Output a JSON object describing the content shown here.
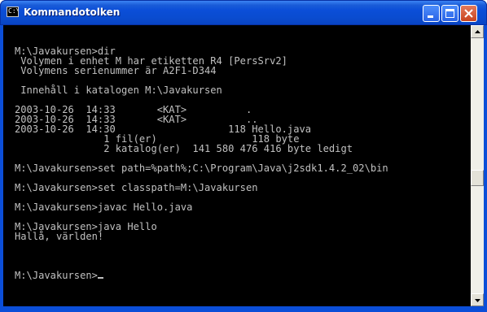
{
  "window": {
    "title": "Kommandotolken",
    "system_icon_text": "C:\\",
    "buttons": [
      "minimize",
      "maximize",
      "close"
    ]
  },
  "console": {
    "lines": [
      "",
      "M:\\Javakursen>dir",
      " Volymen i enhet M har etiketten R4 [PersSrv2]",
      " Volymens serienummer är A2F1-D344",
      "",
      " Innehåll i katalogen M:\\Javakursen",
      "",
      "2003-10-26  14:33       <KAT>          .",
      "2003-10-26  14:33       <KAT>          ..",
      "2003-10-26  14:30                   118 Hello.java",
      "               1 fil(er)                118 byte",
      "               2 katalog(er)  141 580 476 416 byte ledigt",
      "",
      "M:\\Javakursen>set path=%path%;C:\\Program\\Java\\j2sdk1.4.2_02\\bin",
      "",
      "M:\\Javakursen>set classpath=M:\\Javakursen",
      "",
      "M:\\Javakursen>javac Hello.java",
      "",
      "M:\\Javakursen>java Hello",
      "Hallå, världen!",
      "",
      "",
      "",
      "M:\\Javakursen>"
    ],
    "text_color": "#c0c0c0",
    "background": "#000000"
  },
  "colors": {
    "titlebar": "#0b4ed8",
    "close_button": "#c8431e"
  },
  "scrollbar": {
    "position_fraction": 0.55
  }
}
